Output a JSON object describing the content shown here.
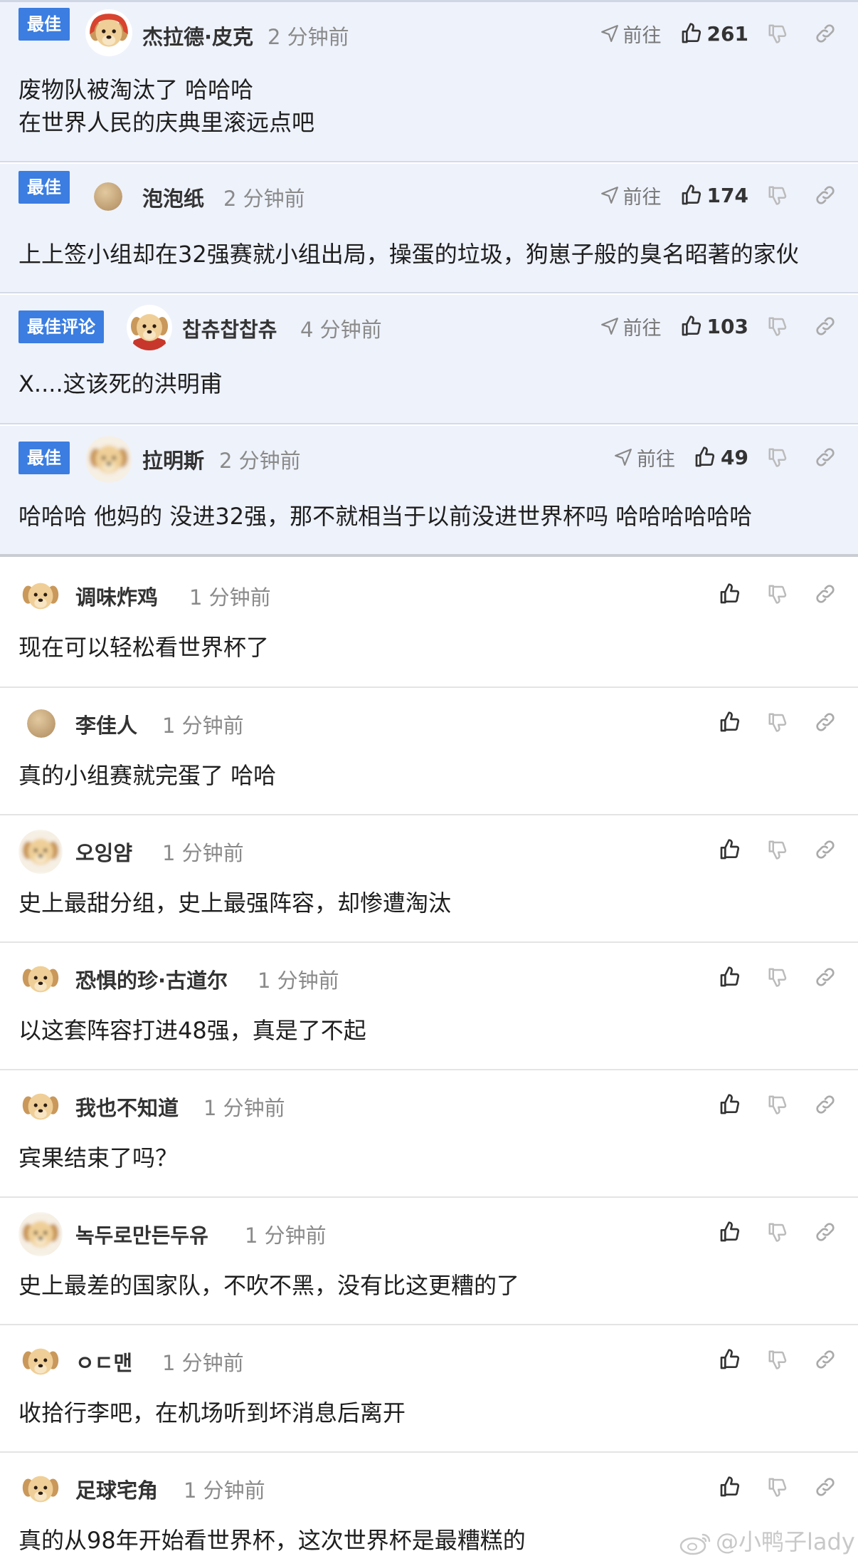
{
  "best_comments": [
    {
      "badge": "最佳",
      "name": "杰拉德·皮克",
      "time": "2 分钟前",
      "goto": "前往",
      "likes": "261",
      "lines": [
        "废物队被淘汰了 哈哈哈",
        "在世界人民的庆典里滚远点吧"
      ],
      "avatar": "puppy-red-hood-icon"
    },
    {
      "badge": "最佳",
      "name": "泡泡纸",
      "time": "2 分钟前",
      "goto": "前往",
      "likes": "174",
      "lines": [
        "上上签小组却在32强赛就小组出局，操蛋的垃圾，狗崽子般的臭名昭著的家伙"
      ],
      "avatar": "beige-circle-icon"
    },
    {
      "badge": "最佳评论",
      "name": "찹츄찹찹츄",
      "time": "4 分钟前",
      "goto": "前往",
      "likes": "103",
      "lines": [
        "X....这该死的洪明甫"
      ],
      "avatar": "puppy-red-cape-icon"
    },
    {
      "badge": "最佳",
      "name": "拉明斯",
      "time": "2 分钟前",
      "goto": "前往",
      "likes": "49",
      "lines": [
        "哈哈哈 他妈的 没进32强，那不就相当于以前没进世界杯吗 哈哈哈哈哈哈"
      ],
      "avatar": "puppy-blurred-icon"
    }
  ],
  "comments": [
    {
      "name": "调味炸鸡",
      "time": "1 分钟前",
      "text": "现在可以轻松看世界杯了",
      "avatar": "puppy-icon"
    },
    {
      "name": "李佳人",
      "time": "1 分钟前",
      "text": "真的小组赛就完蛋了 哈哈",
      "avatar": "beige-circle-icon"
    },
    {
      "name": "오잉얌",
      "time": "1 分钟前",
      "text": "史上最甜分组，史上最强阵容，却惨遭淘汰",
      "avatar": "puppy-blurred-icon"
    },
    {
      "name": "恐惧的珍·古道尔",
      "time": "1 分钟前",
      "text": "以这套阵容打进48强，真是了不起",
      "avatar": "puppy-icon"
    },
    {
      "name": "我也不知道",
      "time": "1 分钟前",
      "text": "宾果结束了吗？",
      "avatar": "puppy-icon"
    },
    {
      "name": "녹두로만든두유",
      "time": "1 分钟前",
      "text": "史上最差的国家队，不吹不黑，没有比这更糟的了",
      "avatar": "puppy-blurred-icon"
    },
    {
      "name": "ㅇㄷ맨",
      "time": "1 分钟前",
      "text": "收拾行李吧，在机场听到坏消息后离开",
      "avatar": "puppy-icon"
    },
    {
      "name": "足球宅角",
      "time": "1 分钟前",
      "text": "真的从98年开始看世界杯，这次世界杯是最糟糕的",
      "avatar": "puppy-icon"
    }
  ],
  "watermark": "@小鸭子lady",
  "colors": {
    "badge": "#3b7de0",
    "best_bg": "#eef2fb",
    "time": "#8a8a8a"
  }
}
